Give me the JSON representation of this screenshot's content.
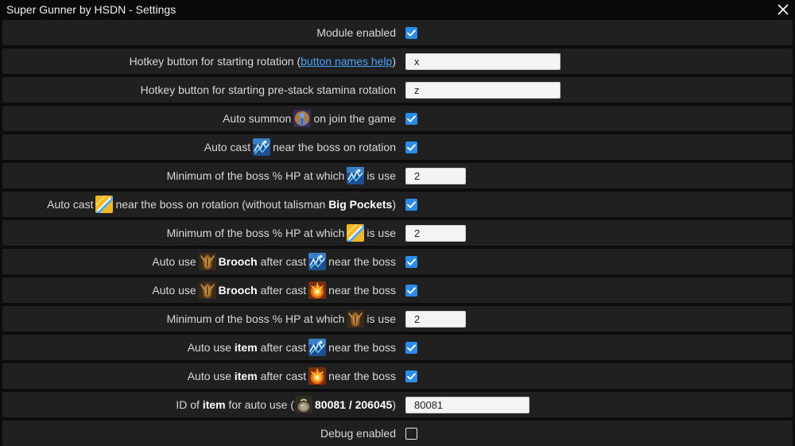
{
  "window": {
    "title": "Super Gunner by HSDN - Settings"
  },
  "rows": {
    "module_enabled": {
      "label": "Module enabled",
      "checked": true
    },
    "hotkey_rotation": {
      "pre": "Hotkey button for starting rotation (",
      "link": "button names help",
      "post": ")",
      "value": "x"
    },
    "hotkey_prestack": {
      "label": "Hotkey button for starting pre-stack stamina rotation",
      "value": "z"
    },
    "auto_summon": {
      "pre": "Auto summon",
      "post": "on join the game",
      "icon": "summon-skill-icon",
      "checked": true
    },
    "auto_cast_1": {
      "pre": "Auto cast",
      "post": "near the boss on rotation",
      "icon": "arcane-barrage-skill-icon",
      "checked": true
    },
    "min_hp_1": {
      "pre": "Minimum of the boss % HP at which",
      "post": "is use",
      "icon": "arcane-barrage-skill-icon",
      "value": "2"
    },
    "auto_cast_2": {
      "pre": "Auto cast",
      "mid": "near the boss on rotation (without talisman",
      "bold": "Big Pockets",
      "post": ")",
      "icon": "lightning-skill-icon",
      "checked": true
    },
    "min_hp_2": {
      "pre": "Minimum of the boss % HP at which",
      "post": "is use",
      "icon": "lightning-skill-icon",
      "value": "2"
    },
    "brooch_1": {
      "pre": "Auto use",
      "bold": "Brooch",
      "mid": "after cast",
      "post": "near the boss",
      "icon1": "brooch-item-icon",
      "icon2": "arcane-barrage-skill-icon",
      "checked": true
    },
    "brooch_2": {
      "pre": "Auto use",
      "bold": "Brooch",
      "mid": "after cast",
      "post": "near the boss",
      "icon1": "brooch-item-icon",
      "icon2": "explosion-skill-icon",
      "checked": true
    },
    "min_hp_3": {
      "pre": "Minimum of the boss % HP at which",
      "post": "is use",
      "icon": "brooch-item-icon",
      "value": "2"
    },
    "item_1": {
      "pre": "Auto use",
      "bold": "item",
      "mid": "after cast",
      "post": "near the boss",
      "icon": "arcane-barrage-skill-icon",
      "checked": true
    },
    "item_2": {
      "pre": "Auto use",
      "bold": "item",
      "mid": "after cast",
      "post": "near the boss",
      "icon": "explosion-skill-icon",
      "checked": true
    },
    "item_id": {
      "pre": "ID of",
      "bold": "item",
      "mid": "for auto use (",
      "bold2": "80081 / 206045",
      "post": ")",
      "icon": "item-pouch-icon",
      "value": "80081"
    },
    "debug": {
      "label": "Debug enabled",
      "checked": false
    }
  },
  "colors": {
    "accent": "#2b8be8",
    "link": "#4aa3ff",
    "row_bg": "#202020",
    "window_bg": "#0c0c0c"
  }
}
